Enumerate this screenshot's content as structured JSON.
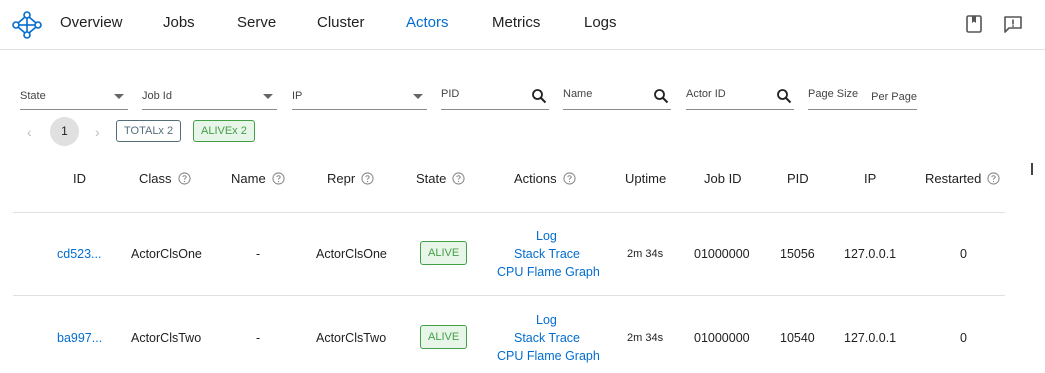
{
  "nav": {
    "items": [
      {
        "label": "Overview",
        "active": false
      },
      {
        "label": "Jobs",
        "active": false
      },
      {
        "label": "Serve",
        "active": false
      },
      {
        "label": "Cluster",
        "active": false
      },
      {
        "label": "Actors",
        "active": true
      },
      {
        "label": "Metrics",
        "active": false
      },
      {
        "label": "Logs",
        "active": false
      }
    ],
    "accent_color": "#036dcf"
  },
  "filters": {
    "state": "State",
    "job_id": "Job Id",
    "ip": "IP",
    "pid": "PID",
    "name": "Name",
    "actor_id": "Actor ID",
    "page_size": "Page Size",
    "per_page": "Per Page"
  },
  "pagination": {
    "prev": "‹",
    "current": "1",
    "next": "›",
    "total_badge": "TOTALx 2",
    "alive_badge": "ALIVEx 2"
  },
  "table": {
    "headers": [
      "ID",
      "Class",
      "Name",
      "Repr",
      "State",
      "Actions",
      "Uptime",
      "Job ID",
      "PID",
      "IP",
      "Restarted"
    ],
    "rows": [
      {
        "id": "cd523...",
        "class": "ActorClsOne",
        "name": "-",
        "repr": "ActorClsOne",
        "state": "ALIVE",
        "actions": [
          "Log",
          "Stack Trace",
          "CPU Flame Graph"
        ],
        "uptime": "2m 34s",
        "job_id": "01000000",
        "pid": "15056",
        "ip": "127.0.0.1",
        "restarted": "0"
      },
      {
        "id": "ba997...",
        "class": "ActorClsTwo",
        "name": "-",
        "repr": "ActorClsTwo",
        "state": "ALIVE",
        "actions": [
          "Log",
          "Stack Trace",
          "CPU Flame Graph"
        ],
        "uptime": "2m 34s",
        "job_id": "01000000",
        "pid": "10540",
        "ip": "127.0.0.1",
        "restarted": "0"
      }
    ]
  }
}
